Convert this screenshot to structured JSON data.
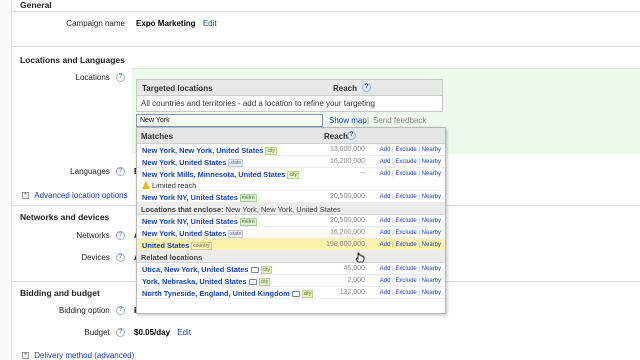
{
  "general": {
    "heading": "General",
    "campaign_name_label": "Campaign name",
    "campaign_name_value": "Expo Marketing",
    "edit_label": "Edit"
  },
  "locations_languages": {
    "heading": "Locations and Languages",
    "locations_label": "Locations",
    "languages_label": "Languages",
    "languages_value_partial": "E",
    "advanced_location_options": "Advanced location options",
    "targeted_locations_header": "Targeted locations",
    "reach_header": "Reach",
    "all_countries_text": "All countries and territories - add a location to refine your targeting",
    "search_value": "New York",
    "show_map": "Show map",
    "separator": "|",
    "send_feedback": "Send feedback"
  },
  "dropdown": {
    "matches_header": "Matches",
    "reach_header": "Reach",
    "action_add": "Add",
    "action_exclude": "Exclude",
    "action_nearby": "Nearby",
    "action_sep": "|",
    "matches": [
      {
        "name": "New York, New York, United States",
        "tag": "city",
        "reach": "13,000,000"
      },
      {
        "name": "New York, United States",
        "tag": "state",
        "reach": "16,200,000"
      },
      {
        "name": "New York Mills, Minnesota, United States",
        "tag": "city",
        "reach": "--"
      }
    ],
    "limited_reach": "Limited reach",
    "match_ny_metro": {
      "name": "New York NY, United States",
      "tag": "metro",
      "reach": "20,500,000"
    },
    "enclose_label": "Locations that enclose:",
    "enclose_value": "New York, New York, United States",
    "enclose": [
      {
        "name": "New York NY, United States",
        "tag": "metro",
        "reach": "20,500,000"
      },
      {
        "name": "New York, United States",
        "tag": "state",
        "reach": "16,200,000"
      },
      {
        "name": "United States",
        "tag": "country",
        "reach": "198,000,000"
      }
    ],
    "related_label": "Related locations",
    "related": [
      {
        "name": "Utica, New York, United States",
        "tag": "city",
        "reach": "45,000"
      },
      {
        "name": "York, Nebraska, United States",
        "tag": "city",
        "reach": "2,000"
      },
      {
        "name": "North Tyneside, England, United Kingdom",
        "tag": "city",
        "reach": "132,000"
      }
    ]
  },
  "networks_devices": {
    "heading": "Networks and devices",
    "networks_label": "Networks",
    "networks_value_partial": "A",
    "devices_label": "Devices",
    "devices_value_partial": "A"
  },
  "bidding": {
    "heading": "Bidding and budget",
    "bidding_option_label": "Bidding option",
    "bidding_value_partial": "F",
    "budget_label": "Budget",
    "budget_value": "$0.05/day",
    "edit_label": "Edit",
    "delivery_method": "Delivery method (advanced)"
  },
  "help_glyph": "?",
  "expand_glyph": "+"
}
